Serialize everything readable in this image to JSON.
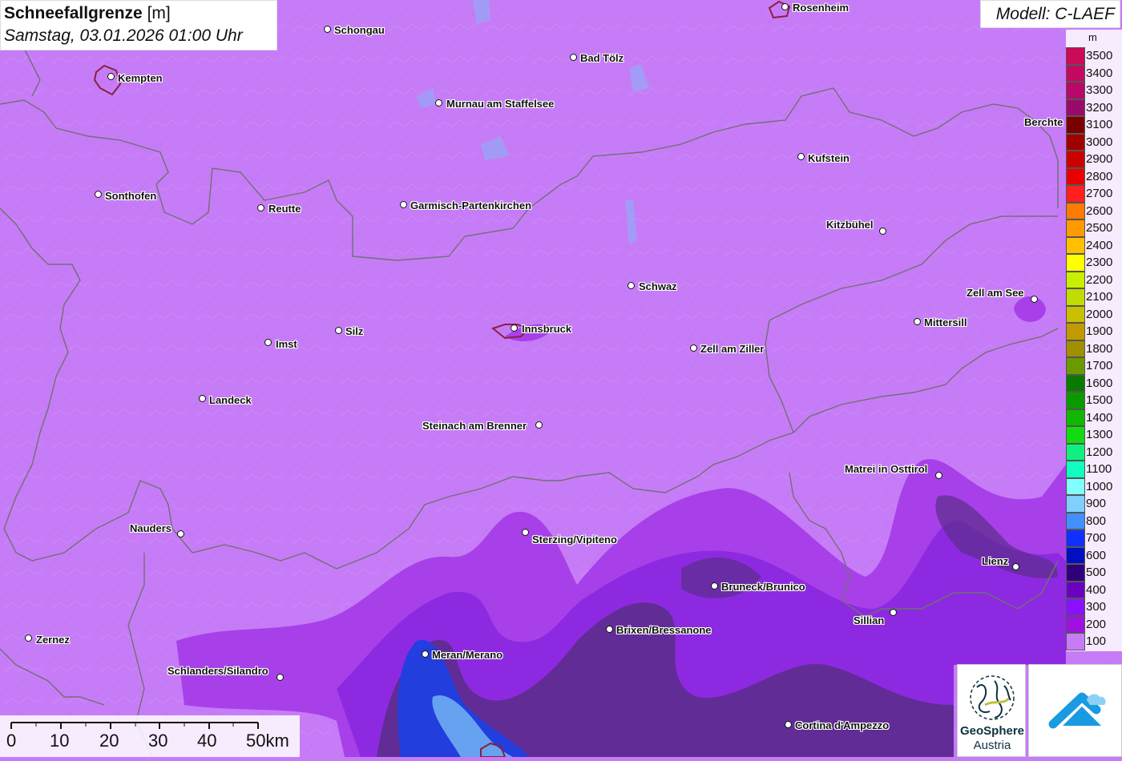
{
  "header": {
    "title": "Schneefallgrenze",
    "unit": "[m]",
    "datetime": "Samstag, 03.01.2026 01:00 Uhr",
    "model": "Modell: C-LAEF"
  },
  "legend": {
    "unit": "m",
    "items": [
      {
        "label": "3500",
        "color": "#cc0a55"
      },
      {
        "label": "3400",
        "color": "#c40a60"
      },
      {
        "label": "3300",
        "color": "#b8086a"
      },
      {
        "label": "3200",
        "color": "#9a0a6a"
      },
      {
        "label": "3100",
        "color": "#7a0000"
      },
      {
        "label": "3000",
        "color": "#a00000"
      },
      {
        "label": "2900",
        "color": "#cc0000"
      },
      {
        "label": "2800",
        "color": "#e80000"
      },
      {
        "label": "2700",
        "color": "#ff2020"
      },
      {
        "label": "2600",
        "color": "#ff7a00"
      },
      {
        "label": "2500",
        "color": "#ff9a00"
      },
      {
        "label": "2400",
        "color": "#ffc000"
      },
      {
        "label": "2300",
        "color": "#ffff00"
      },
      {
        "label": "2200",
        "color": "#c8f000"
      },
      {
        "label": "2100",
        "color": "#c0dc00"
      },
      {
        "label": "2000",
        "color": "#c8c000"
      },
      {
        "label": "1900",
        "color": "#c09a00"
      },
      {
        "label": "1800",
        "color": "#a09000"
      },
      {
        "label": "1700",
        "color": "#6a9a00"
      },
      {
        "label": "1600",
        "color": "#0a7a00"
      },
      {
        "label": "1500",
        "color": "#0a9a00"
      },
      {
        "label": "1400",
        "color": "#10b800"
      },
      {
        "label": "1300",
        "color": "#10dc10"
      },
      {
        "label": "1200",
        "color": "#10f080"
      },
      {
        "label": "1100",
        "color": "#10ffc0"
      },
      {
        "label": "1000",
        "color": "#80ffff"
      },
      {
        "label": "900",
        "color": "#80d0ff"
      },
      {
        "label": "800",
        "color": "#4090ff"
      },
      {
        "label": "700",
        "color": "#1030ff"
      },
      {
        "label": "600",
        "color": "#0010c0"
      },
      {
        "label": "500",
        "color": "#30007a"
      },
      {
        "label": "400",
        "color": "#6a00c0"
      },
      {
        "label": "300",
        "color": "#8a10ff"
      },
      {
        "label": "200",
        "color": "#a010e0"
      },
      {
        "label": "100",
        "color": "#c77cf7"
      }
    ]
  },
  "scale": {
    "labels": [
      "0",
      "10",
      "20",
      "30",
      "40",
      "50km"
    ]
  },
  "cities": [
    {
      "name": "Rosenheim"
    },
    {
      "name": "Schongau"
    },
    {
      "name": "Kempten"
    },
    {
      "name": "Bad Tölz"
    },
    {
      "name": "Murnau am Staffelsee"
    },
    {
      "name": "Berchte"
    },
    {
      "name": "Kufstein"
    },
    {
      "name": "Sonthofen"
    },
    {
      "name": "Reutte"
    },
    {
      "name": "Garmisch-Partenkirchen"
    },
    {
      "name": "Kitzbühel"
    },
    {
      "name": "Schwaz"
    },
    {
      "name": "Zell am See"
    },
    {
      "name": "Mittersill"
    },
    {
      "name": "Silz"
    },
    {
      "name": "Innsbruck"
    },
    {
      "name": "Imst"
    },
    {
      "name": "Zell am Ziller"
    },
    {
      "name": "Landeck"
    },
    {
      "name": "Steinach am Brenner"
    },
    {
      "name": "Matrei in Osttirol"
    },
    {
      "name": "Nauders"
    },
    {
      "name": "Sterzing/Vipiteno"
    },
    {
      "name": "Lienz"
    },
    {
      "name": "Bruneck/Brunico"
    },
    {
      "name": "Sillian"
    },
    {
      "name": "Brixen/Bressanone"
    },
    {
      "name": "Zernez"
    },
    {
      "name": "Meran/Merano"
    },
    {
      "name": "Schlanders/Silandro"
    },
    {
      "name": "Cortina d'Ampezzo"
    }
  ],
  "logos": {
    "geosphere_line1": "GeoSphere",
    "geosphere_line2": "Austria"
  }
}
